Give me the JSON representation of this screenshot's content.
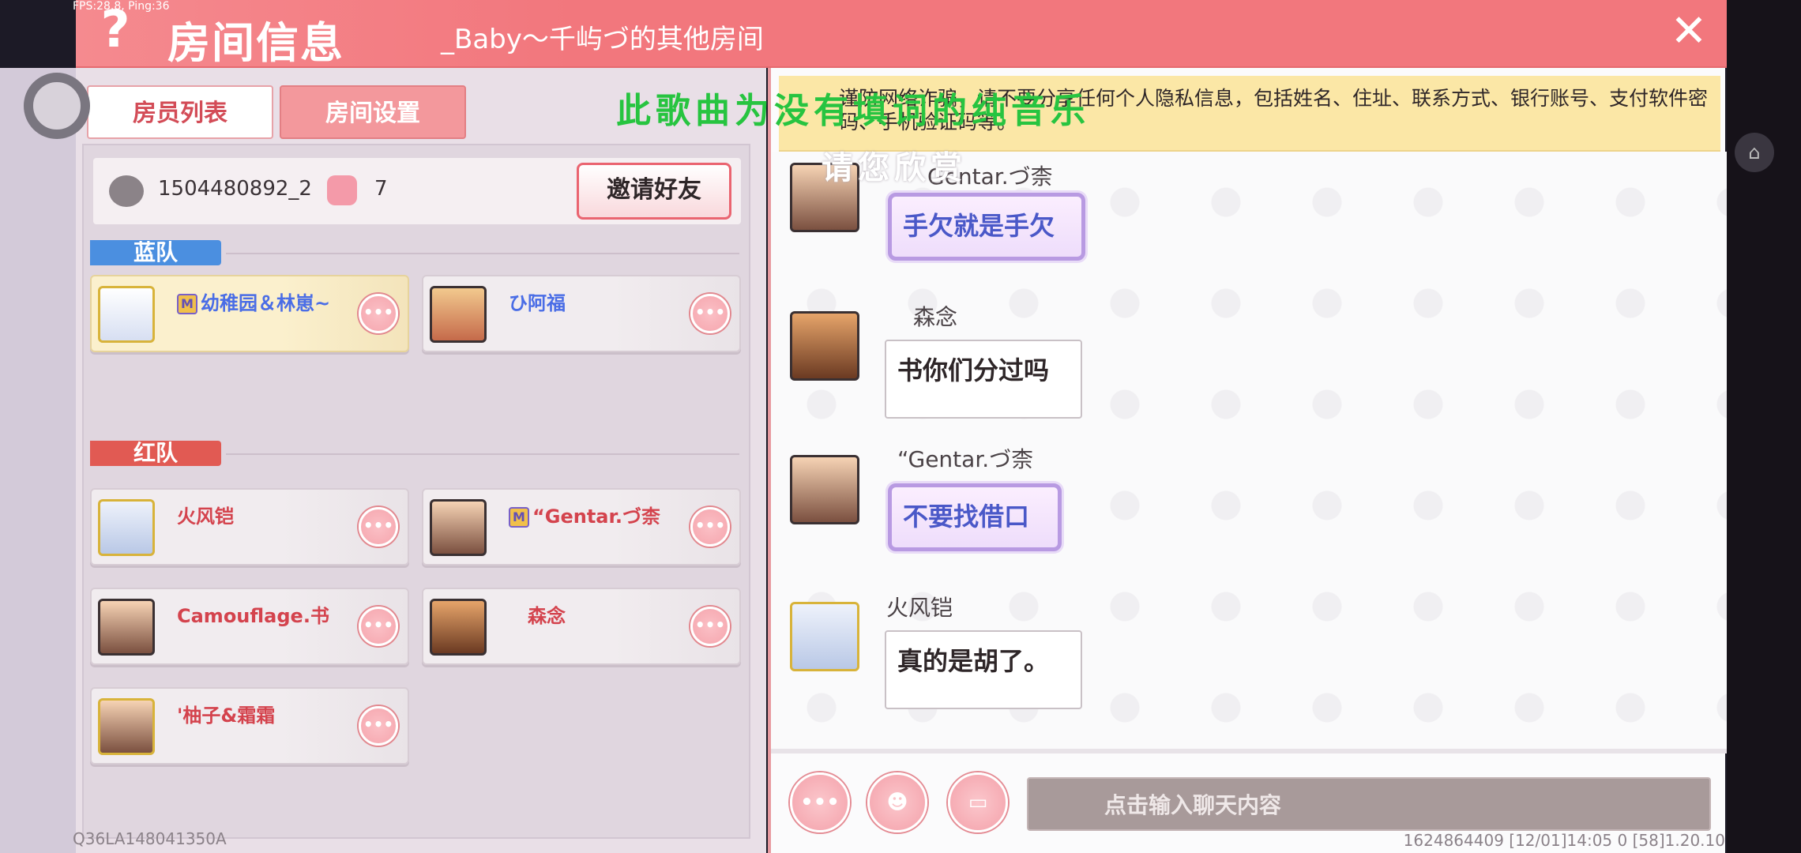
{
  "status": {
    "fps": "FPS:28.8, Ping:36"
  },
  "header": {
    "help_icon": "?",
    "title": "房间信息",
    "subtitle": "_Baby～千屿づ的其他房间",
    "close_icon": "✕"
  },
  "tabs": [
    {
      "label": "房员列表",
      "active": true
    },
    {
      "label": "房间设置",
      "active": false
    }
  ],
  "room": {
    "id": "1504480892_2",
    "member_count": "7",
    "invite_label": "邀请好友"
  },
  "teams": {
    "blue": {
      "label": "蓝队",
      "members": [
        {
          "name": "幼稚园＆林崽~",
          "badge": "M"
        },
        {
          "name": "ひ阿福"
        }
      ]
    },
    "red": {
      "label": "红队",
      "members": [
        {
          "name": "火风铠"
        },
        {
          "name": "“Gentar.づ柰",
          "badge": "M"
        },
        {
          "name": "Camouflage.书"
        },
        {
          "name": "森念"
        },
        {
          "name": "'柚子&霜霜"
        }
      ]
    }
  },
  "more_icon": "•••",
  "device_id": "Q36LA148041350A",
  "chat": {
    "notice": "谨防网络诈骗，请不要分享任何个人隐私信息，包括姓名、住址、联系方式、银行账号、支付软件密码、手机验证码等。",
    "overlay_green": "此歌曲为没有填词的纯音乐",
    "overlay_white": "请您欣赏",
    "messages": [
      {
        "name": "Gentar.づ柰",
        "text": "手欠就是手欠",
        "fancy": true
      },
      {
        "name": "森念",
        "text": "书你们分过吗",
        "fancy": false
      },
      {
        "name": "“Gentar.づ柰",
        "text": "不要找借口",
        "fancy": true
      },
      {
        "name": "火风铠",
        "text": "真的是胡了。",
        "fancy": false
      }
    ],
    "input_placeholder": "点击输入聊天内容",
    "footer": "1624864409    [12/01]14:05 0    [58]1.20.10"
  },
  "colors": {
    "header": "#f2777d",
    "blue_team": "#4b8fe0",
    "red_team": "#e15a53",
    "notice_bg": "#fbe7a6"
  }
}
